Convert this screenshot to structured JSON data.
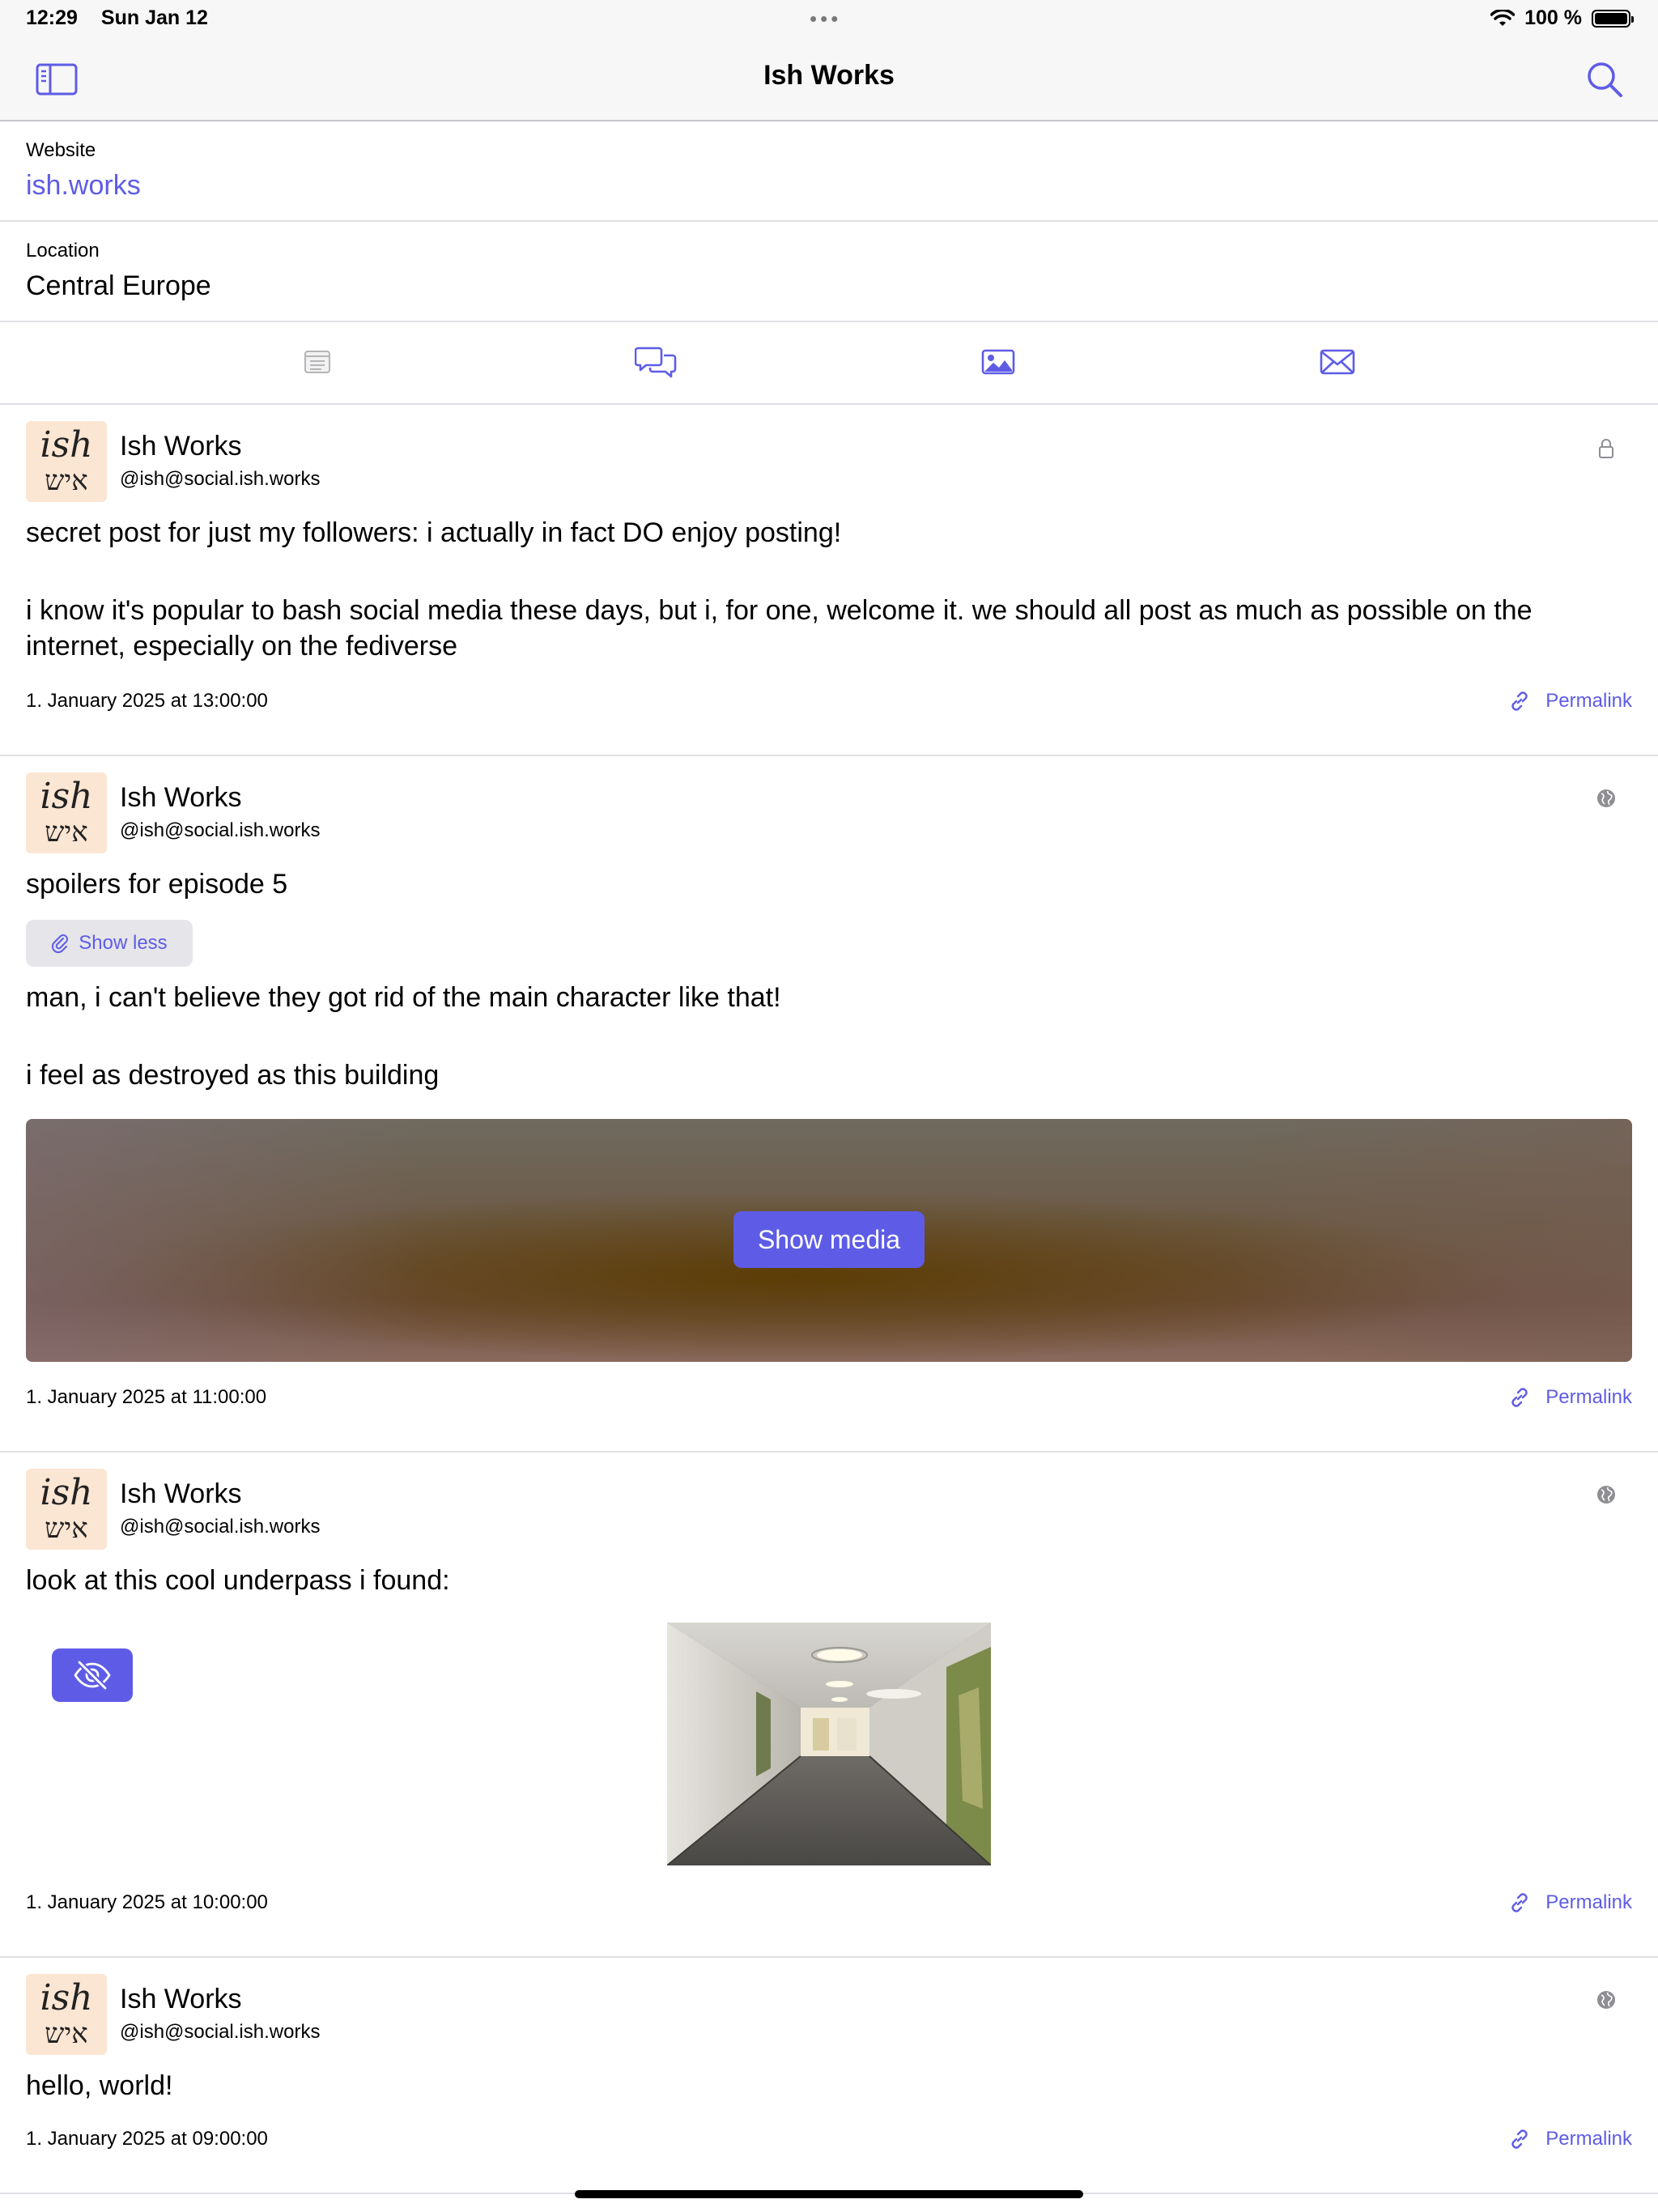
{
  "status_bar": {
    "time": "12:29",
    "date": "Sun Jan 12",
    "dots": "•••",
    "battery": "100 %"
  },
  "nav": {
    "title": "Ish Works",
    "sidebar_icon": "sidebar-icon",
    "search_icon": "search-icon"
  },
  "profile": {
    "website_label": "Website",
    "website_value": "ish.works",
    "location_label": "Location",
    "location_value": "Central Europe"
  },
  "tabs": [
    {
      "icon": "posts-icon",
      "active": false
    },
    {
      "icon": "replies-icon",
      "active": true
    },
    {
      "icon": "media-icon",
      "active": true
    },
    {
      "icon": "mail-icon",
      "active": true
    }
  ],
  "avatar": {
    "text_en": "ish",
    "text_he": "איש"
  },
  "posts": [
    {
      "author": "Ish Works",
      "handle": "@ish@social.ish.works",
      "visibility_icon": "lock-icon",
      "text1": "secret post for just my followers: i actually in fact DO enjoy posting!",
      "text2": "i know it's popular to bash social media these days, but i, for one, welcome it. we should all post as much as possible on the internet, especially on the fediverse",
      "date": "1. January 2025 at 13:00:00",
      "permalink": "Permalink"
    },
    {
      "author": "Ish Works",
      "handle": "@ish@social.ish.works",
      "visibility_icon": "globe-icon",
      "content_warning": "spoilers for episode 5",
      "show_less": "Show less",
      "text1": "man, i can't believe they got rid of the main character like that!",
      "text2": "i feel as destroyed as this building",
      "show_media": "Show media",
      "date": "1. January 2025 at 11:00:00",
      "permalink": "Permalink"
    },
    {
      "author": "Ish Works",
      "handle": "@ish@social.ish.works",
      "visibility_icon": "globe-icon",
      "text1": "look at this cool underpass i found:",
      "date": "1. January 2025 at 10:00:00",
      "permalink": "Permalink"
    },
    {
      "author": "Ish Works",
      "handle": "@ish@social.ish.works",
      "visibility_icon": "globe-icon",
      "text1": "hello, world!",
      "date": "1. January 2025 at 09:00:00",
      "permalink": "Permalink"
    }
  ],
  "colors": {
    "accent": "#5e5ce6",
    "bar_bg": "#f7f7f7",
    "separator": "#e0e0e5",
    "avatar_bg": "#fbe6d3"
  }
}
